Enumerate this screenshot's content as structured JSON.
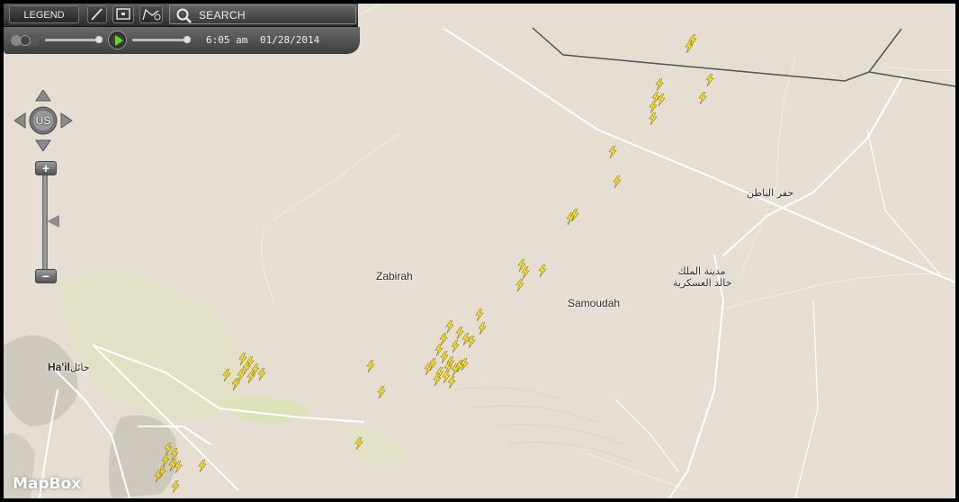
{
  "toolbar": {
    "legend_label": "LEGEND",
    "search_label": "SEARCH",
    "draw_icon": "pencil-icon",
    "box_icon": "select-box-icon",
    "route_icon": "route-icon",
    "search_icon": "magnifier-icon"
  },
  "timeline": {
    "time": "6:05 am",
    "date": "01/28/2014",
    "play_icon": "play-icon"
  },
  "nav": {
    "pan_label": "US",
    "zoom_in": "+",
    "zoom_out": "−"
  },
  "map": {
    "places": {
      "zabirah": "Zabirah",
      "samoudah": "Samoudah",
      "hail_latin": "Ha'il",
      "hail_arabic": "حائل",
      "hafr": "حفر الباطن",
      "kmc_line1": "مدينة الملك",
      "kmc_line2": "خالد العسكرية"
    },
    "attribution": "MapBox",
    "colors": {
      "land": "#e6ddd3",
      "roads": "#ffffff",
      "border": "#4a5556",
      "vegetation": "#dfe5b8",
      "lightning": "#f3e23a"
    }
  }
}
